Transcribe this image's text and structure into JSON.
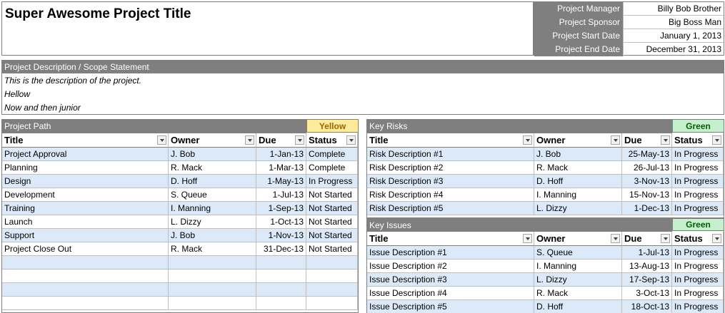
{
  "title": "Super Awesome Project Title",
  "info": [
    {
      "label": "Project Manager",
      "value": "Billy Bob Brother"
    },
    {
      "label": "Project Sponsor",
      "value": "Big Boss Man"
    },
    {
      "label": "Project Start Date",
      "value": "January 1, 2013"
    },
    {
      "label": "Project End Date",
      "value": "December 31, 2013"
    }
  ],
  "description": {
    "header": "Project Description / Scope Statement",
    "lines": [
      "This is the description of the project.",
      "Hellow",
      "Now and then junior"
    ]
  },
  "colors": {
    "header_gray": "#7f7f7f",
    "row_shade": "#dce9f8",
    "yellow_bg": "#ffeb9c",
    "yellow_text": "#9c6500",
    "green_bg": "#c6efce",
    "green_text": "#006100"
  },
  "path": {
    "header": "Project Path",
    "status": "Yellow",
    "columns": [
      "Title",
      "Owner",
      "Due",
      "Status"
    ],
    "rows": [
      [
        "Project Approval",
        "J. Bob",
        "1-Jan-13",
        "Complete"
      ],
      [
        "Planning",
        "R. Mack",
        "1-Mar-13",
        "Complete"
      ],
      [
        "Design",
        "D. Hoff",
        "1-May-13",
        "In Progress"
      ],
      [
        "Development",
        "S. Queue",
        "1-Jul-13",
        "Not Started"
      ],
      [
        "Training",
        "I. Manning",
        "1-Sep-13",
        "Not Started"
      ],
      [
        "Launch",
        "L. Dizzy",
        "1-Oct-13",
        "Not Started"
      ],
      [
        "Support",
        "J. Bob",
        "1-Nov-13",
        "Not Started"
      ],
      [
        "Project Close Out",
        "R. Mack",
        "31-Dec-13",
        "Not Started"
      ],
      [
        "",
        "",
        "",
        ""
      ],
      [
        "",
        "",
        "",
        ""
      ],
      [
        "",
        "",
        "",
        ""
      ],
      [
        "",
        "",
        "",
        ""
      ]
    ]
  },
  "risks": {
    "header": "Key Risks",
    "status": "Green",
    "columns": [
      "Title",
      "Owner",
      "Due",
      "Status"
    ],
    "rows": [
      [
        "Risk Description #1",
        "J. Bob",
        "25-May-13",
        "In Progress"
      ],
      [
        "Risk Description #2",
        "R. Mack",
        "26-Jul-13",
        "In Progress"
      ],
      [
        "Risk Description #3",
        "D. Hoff",
        "3-Nov-13",
        "In Progress"
      ],
      [
        "Risk Description #4",
        "I. Manning",
        "15-Nov-13",
        "In Progress"
      ],
      [
        "Risk Description #5",
        "L. Dizzy",
        "1-Dec-13",
        "In Progress"
      ]
    ]
  },
  "issues": {
    "header": "Key Issues",
    "status": "Green",
    "columns": [
      "Title",
      "Owner",
      "Due",
      "Status"
    ],
    "rows": [
      [
        "Issue Description #1",
        "S. Queue",
        "1-Jul-13",
        "In Progress"
      ],
      [
        "Issue Description #2",
        "I. Manning",
        "13-Aug-13",
        "In Progress"
      ],
      [
        "Issue Description #3",
        "L. Dizzy",
        "17-Sep-13",
        "In Progress"
      ],
      [
        "Issue Description #4",
        "R. Mack",
        "3-Oct-13",
        "In Progress"
      ],
      [
        "Issue Description #5",
        "D. Hoff",
        "18-Oct-13",
        "In Progress"
      ]
    ]
  }
}
